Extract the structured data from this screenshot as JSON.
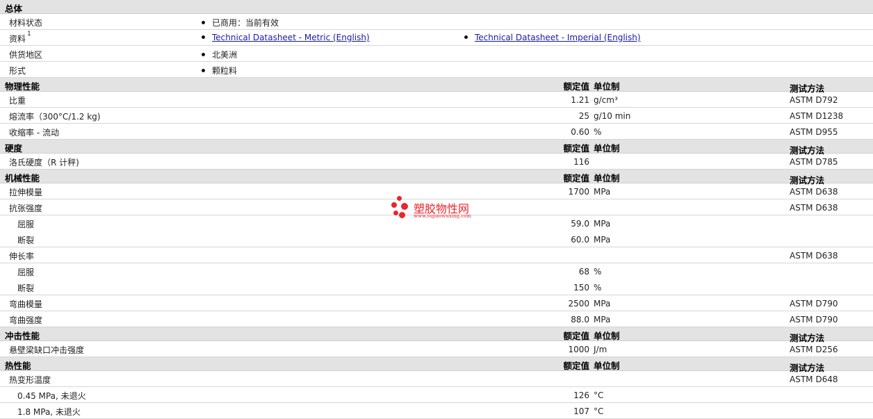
{
  "general": {
    "title": "总体",
    "material_status": {
      "label": "材料状态",
      "value": "已商用：当前有效"
    },
    "resources": {
      "label": "资料",
      "sup": "1",
      "link1": "Technical Datasheet - Metric (English)",
      "link2": "Technical Datasheet - Imperial (English)"
    },
    "region": {
      "label": "供货地区",
      "value": "北美洲"
    },
    "form": {
      "label": "形式",
      "value": "颗粒料"
    }
  },
  "headers": {
    "value": "额定值",
    "unit": "单位制",
    "test": "测试方法"
  },
  "physical": {
    "title": "物理性能",
    "rows": [
      {
        "label": "比重",
        "value": "1.21",
        "unit": "g/cm³",
        "test": "ASTM D792"
      },
      {
        "label": "熔流率（300°C/1.2 kg)",
        "value": "25",
        "unit": "g/10 min",
        "test": "ASTM D1238"
      },
      {
        "label": "收缩率 - 流动",
        "value": "0.60",
        "unit": "%",
        "test": "ASTM D955"
      }
    ]
  },
  "hardness": {
    "title": "硬度",
    "rows": [
      {
        "label": "洛氏硬度（R 计秤)",
        "value": "116",
        "unit": "",
        "test": "ASTM D785"
      }
    ]
  },
  "mechanical": {
    "title": "机械性能",
    "rows": [
      {
        "label": "拉伸模量",
        "value": "1700",
        "unit": "MPa",
        "test": "ASTM D638"
      },
      {
        "label": "抗张强度",
        "value": "",
        "unit": "",
        "test": "ASTM D638"
      },
      {
        "label": "屈服",
        "value": "59.0",
        "unit": "MPa",
        "test": ""
      },
      {
        "label": "断裂",
        "value": "60.0",
        "unit": "MPa",
        "test": ""
      },
      {
        "label": "伸长率",
        "value": "",
        "unit": "",
        "test": "ASTM D638"
      },
      {
        "label": "屈服",
        "value": "68",
        "unit": "%",
        "test": ""
      },
      {
        "label": "断裂",
        "value": "150",
        "unit": "%",
        "test": ""
      },
      {
        "label": "弯曲模量",
        "value": "2500",
        "unit": "MPa",
        "test": "ASTM D790"
      },
      {
        "label": "弯曲强度",
        "value": "88.0",
        "unit": "MPa",
        "test": "ASTM D790"
      }
    ]
  },
  "impact": {
    "title": "冲击性能",
    "rows": [
      {
        "label": "悬壁梁缺口冲击强度",
        "value": "1000",
        "unit": "J/m",
        "test": "ASTM D256"
      }
    ]
  },
  "thermal": {
    "title": "热性能",
    "rows": [
      {
        "label": "热变形温度",
        "value": "",
        "unit": "",
        "test": "ASTM D648"
      },
      {
        "label": "0.45 MPa, 未退火",
        "value": "126",
        "unit": "°C",
        "test": ""
      },
      {
        "label": "1.8 MPa, 未退火",
        "value": "107",
        "unit": "°C",
        "test": ""
      }
    ]
  },
  "watermark": {
    "name": "塑胶物性网",
    "url": "www.sujiaowuxing.com"
  }
}
